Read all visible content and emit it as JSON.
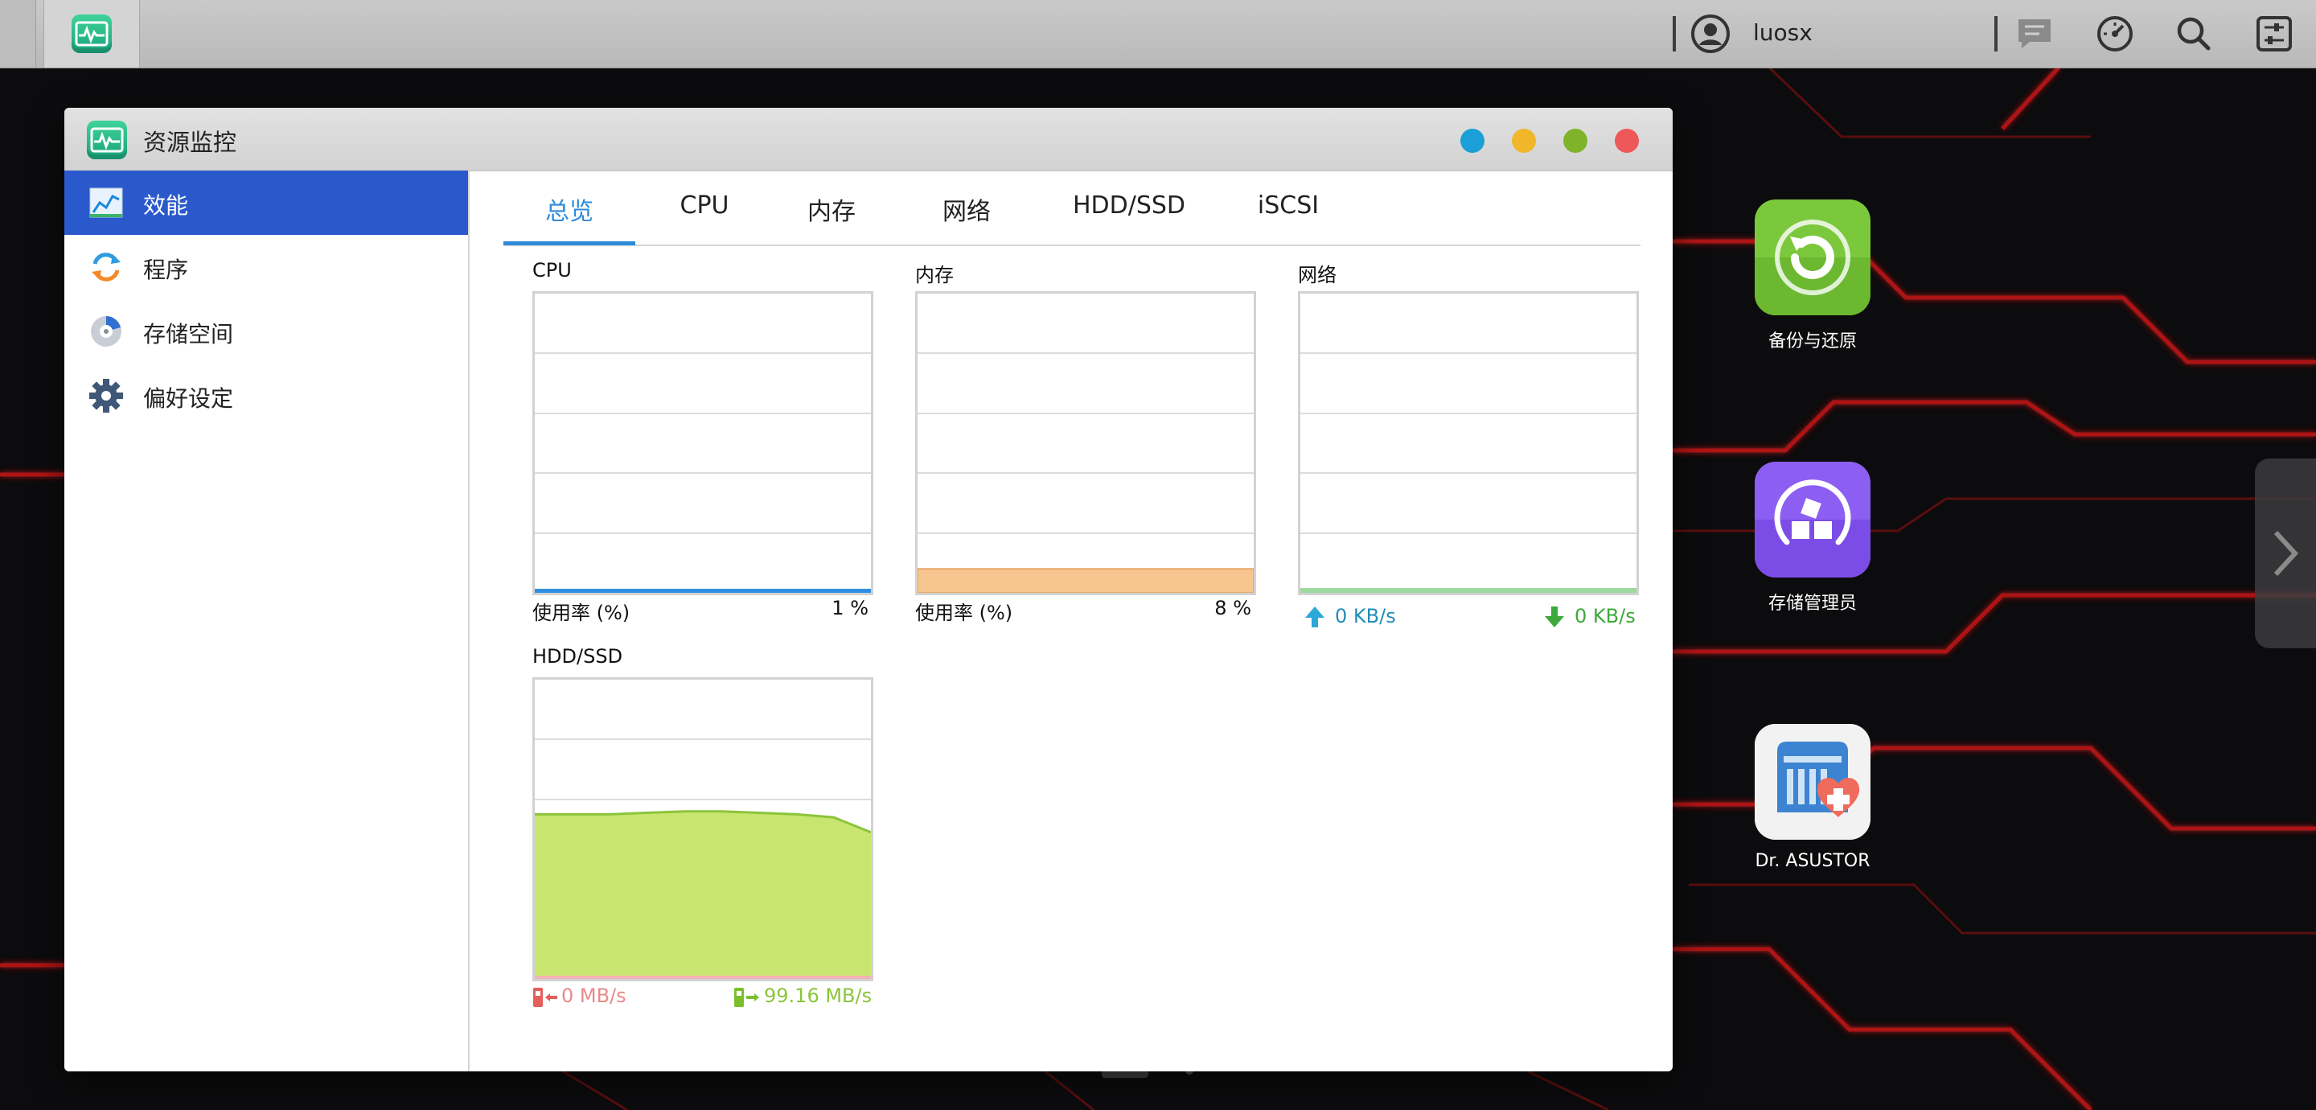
{
  "taskbar": {
    "username": "luosx"
  },
  "window": {
    "title": "资源监控"
  },
  "sidebar": {
    "items": [
      {
        "label": "效能",
        "icon": "performance-chart-icon",
        "active": true
      },
      {
        "label": "程序",
        "icon": "process-cycle-icon",
        "active": false
      },
      {
        "label": "存储空间",
        "icon": "storage-disk-icon",
        "active": false
      },
      {
        "label": "偏好设定",
        "icon": "gear-icon",
        "active": false
      }
    ]
  },
  "tabs": [
    {
      "label": "总览",
      "active": true
    },
    {
      "label": "CPU",
      "active": false
    },
    {
      "label": "内存",
      "active": false
    },
    {
      "label": "网络",
      "active": false
    },
    {
      "label": "HDD/SSD",
      "active": false
    },
    {
      "label": "iSCSI",
      "active": false
    }
  ],
  "panels": {
    "cpu": {
      "title": "CPU",
      "usage_label": "使用率 (%)",
      "usage_value": "1 %",
      "usage_percent": 1,
      "color": "#2e8fe0"
    },
    "memory": {
      "title": "内存",
      "usage_label": "使用率 (%)",
      "usage_value": "8 %",
      "usage_percent": 8,
      "color": "#f7c690"
    },
    "network": {
      "title": "网络",
      "upload": "0 KB/s",
      "download": "0 KB/s",
      "upload_color": "#1f8fb6",
      "download_color": "#3ca93c"
    },
    "disk": {
      "title": "HDD/SSD",
      "read": "0 MB/s",
      "write": "99.16 MB/s",
      "read_color": "#e88a8a",
      "write_color": "#8cc43a",
      "write_history_percent": [
        55,
        55,
        55,
        55.5,
        56,
        56,
        55.5,
        55,
        54,
        49
      ]
    }
  },
  "desktop": {
    "shortcuts": [
      {
        "label": "备份与还原",
        "icon": "backup-restore-icon",
        "color": "#7ec93f"
      },
      {
        "label": "存储管理员",
        "icon": "storage-manager-icon",
        "color": "#8b5cf0"
      },
      {
        "label": "Dr. ASUSTOR",
        "icon": "dr-asustor-icon",
        "color": "#3f88d6"
      }
    ]
  },
  "window_buttons": [
    "#1aa0d6",
    "#f2b62b",
    "#7fb42a",
    "#ef5858"
  ]
}
